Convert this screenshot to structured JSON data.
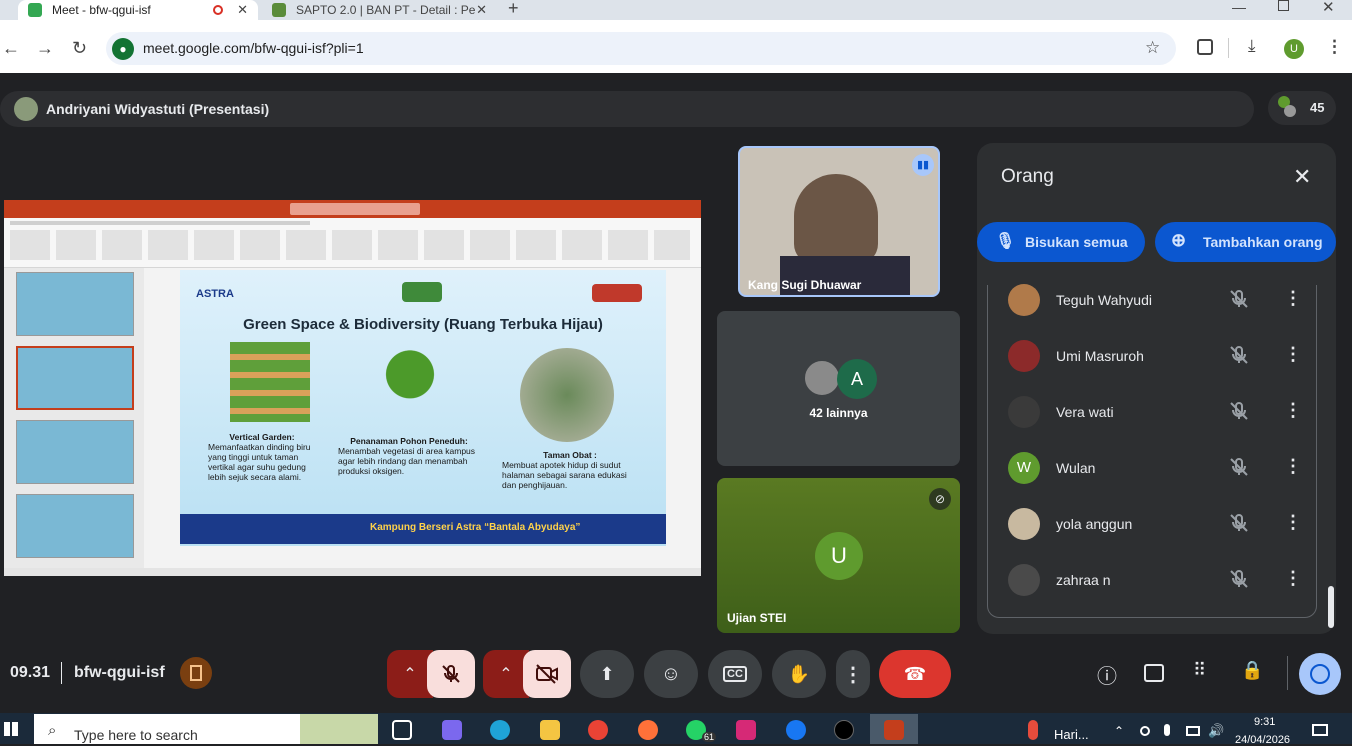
{
  "browser": {
    "tabs": [
      {
        "title": "Meet - bfw-qgui-isf",
        "favicon": "meet-icon"
      },
      {
        "title": "SAPTO 2.0 | BAN PT - Detail : Pe",
        "favicon": "sapto-icon"
      }
    ],
    "url": "meet.google.com/bfw-qgui-isf?pli=1",
    "profile_initial": "U"
  },
  "meet": {
    "presenter_label": "Andriyani Widyastuti (Presentasi)",
    "participant_count": "45",
    "presentation": {
      "slide_title": "Green Space & Biodiversity (Ruang Terbuka Hijau)",
      "brand": "ASTRA",
      "col1_title": "Vertical Garden:",
      "col1_text": "Memanfaatkan dinding biru yang tinggi untuk taman vertikal agar suhu gedung lebih sejuk secara alami.",
      "col2_title": "Penanaman Pohon Peneduh:",
      "col2_text": "Menambah vegetasi di area kampus agar lebih rindang dan menambah produksi oksigen.",
      "col3_title": "Taman Obat :",
      "col3_text": "Membuat apotek hidup di sudut halaman sebagai sarana edukasi dan penghijauan.",
      "footer": "Kampung Berseri Astra “Bantala Abyudaya”"
    },
    "tiles": {
      "main_speaker": "Kang Sugi Dhuawar",
      "others_label": "42 lainnya",
      "others_initial": "A",
      "ujian_name": "Ujian STEI",
      "ujian_initial": "U"
    },
    "panel": {
      "title": "Orang",
      "mute_all": "Bisukan semua",
      "add_people": "Tambahkan orang",
      "people": [
        {
          "name": "Teguh Wahyudi",
          "avatar_color": "#b07a4a"
        },
        {
          "name": "Umi Masruroh",
          "avatar_color": "#8c2a2a"
        },
        {
          "name": "Vera wati",
          "avatar_color": "#3a3a3a"
        },
        {
          "name": "Wulan",
          "avatar_color": "#5f9b2e",
          "initial": "W"
        },
        {
          "name": "yola anggun",
          "avatar_color": "#c8b9a0"
        },
        {
          "name": "zahraa n",
          "avatar_color": "#4a4a4a"
        }
      ]
    },
    "bottom": {
      "time": "09.31",
      "meeting_code": "bfw-qgui-isf"
    }
  },
  "taskbar": {
    "search_placeholder": "Type here to search",
    "weather": "Hari...",
    "clock_time": "9:31",
    "clock_date": "24/04/2026",
    "whatsapp_badge": "61"
  }
}
